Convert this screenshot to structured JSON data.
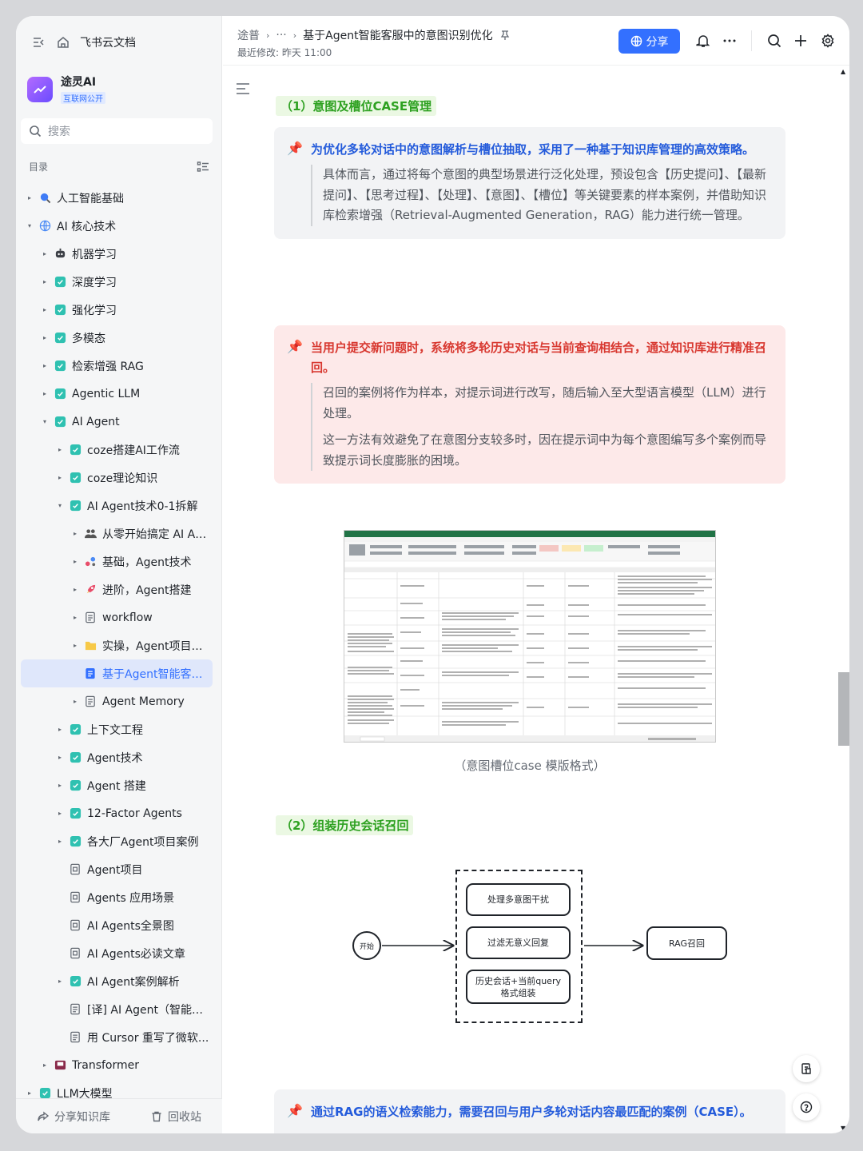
{
  "sidebar": {
    "home_title": "飞书云文档",
    "space": {
      "name": "途灵AI",
      "badge": "互联网公开"
    },
    "search_placeholder": "搜索",
    "toc_label": "目录",
    "items": [
      {
        "label": "人工智能基础",
        "level": 0,
        "caret": "▸",
        "icon": "search-icon"
      },
      {
        "label": "AI 核心技术",
        "level": 0,
        "caret": "▾",
        "icon": "globe-icon"
      },
      {
        "label": "机器学习",
        "level": 1,
        "caret": "▸",
        "icon": "robot-icon"
      },
      {
        "label": "深度学习",
        "level": 1,
        "caret": "▸",
        "icon": "wiki-icon"
      },
      {
        "label": "强化学习",
        "level": 1,
        "caret": "▸",
        "icon": "wiki-icon"
      },
      {
        "label": "多模态",
        "level": 1,
        "caret": "▸",
        "icon": "wiki-icon"
      },
      {
        "label": "检索增强 RAG",
        "level": 1,
        "caret": "▸",
        "icon": "wiki-icon"
      },
      {
        "label": "Agentic LLM",
        "level": 1,
        "caret": "▸",
        "icon": "wiki-icon"
      },
      {
        "label": "AI Agent",
        "level": 1,
        "caret": "▾",
        "icon": "wiki-icon"
      },
      {
        "label": "coze搭建AI工作流",
        "level": 2,
        "caret": "▸",
        "icon": "wiki-icon"
      },
      {
        "label": "coze理论知识",
        "level": 2,
        "caret": "▸",
        "icon": "wiki-icon"
      },
      {
        "label": "AI Agent技术0-1拆解",
        "level": 2,
        "caret": "▾",
        "icon": "wiki-icon"
      },
      {
        "label": "从零开始搞定 AI Ag...",
        "level": 3,
        "caret": "▸",
        "icon": "people-icon"
      },
      {
        "label": "基础，Agent技术",
        "level": 3,
        "caret": "▸",
        "icon": "molecule-icon"
      },
      {
        "label": "进阶，Agent搭建",
        "level": 3,
        "caret": "▸",
        "icon": "rocket-icon"
      },
      {
        "label": "workflow",
        "level": 3,
        "caret": "▸",
        "icon": "doc-icon"
      },
      {
        "label": "实操，Agent项目专项",
        "level": 3,
        "caret": "▸",
        "icon": "folder-icon"
      },
      {
        "label": "基于Agent智能客服...",
        "level": 3,
        "caret": "",
        "icon": "doc-blue-icon",
        "active": true
      },
      {
        "label": "Agent Memory",
        "level": 3,
        "caret": "▸",
        "icon": "doc-icon"
      },
      {
        "label": "上下文工程",
        "level": 2,
        "caret": "▸",
        "icon": "wiki-icon"
      },
      {
        "label": "Agent技术",
        "level": 2,
        "caret": "▸",
        "icon": "wiki-icon"
      },
      {
        "label": "Agent 搭建",
        "level": 2,
        "caret": "▸",
        "icon": "wiki-icon"
      },
      {
        "label": "12-Factor Agents",
        "level": 2,
        "caret": "▸",
        "icon": "wiki-icon"
      },
      {
        "label": "各大厂Agent项目案例",
        "level": 2,
        "caret": "▸",
        "icon": "wiki-icon"
      },
      {
        "label": "Agent项目",
        "level": 2,
        "caret": "",
        "icon": "board-icon"
      },
      {
        "label": "Agents 应用场景",
        "level": 2,
        "caret": "",
        "icon": "board-icon"
      },
      {
        "label": "AI Agents全景图",
        "level": 2,
        "caret": "",
        "icon": "board-icon"
      },
      {
        "label": "AI Agents必读文章",
        "level": 2,
        "caret": "",
        "icon": "board-icon"
      },
      {
        "label": "AI Agent案例解析",
        "level": 2,
        "caret": "▸",
        "icon": "wiki-icon"
      },
      {
        "label": "[译] AI Agent（智能体...",
        "level": 2,
        "caret": "",
        "icon": "doc-icon"
      },
      {
        "label": "用 Cursor 重写了微软...",
        "level": 2,
        "caret": "",
        "icon": "doc-icon"
      },
      {
        "label": "Transformer",
        "level": 1,
        "caret": "▸",
        "icon": "film-icon"
      },
      {
        "label": "LLM大模型",
        "level": 0,
        "caret": "▸",
        "icon": "wiki-icon"
      }
    ],
    "bottom": {
      "share": "分享知识库",
      "trash": "回收站"
    }
  },
  "header": {
    "breadcrumb": [
      "途普",
      "···",
      "基于Agent智能客服中的意图识别优化"
    ],
    "modified": "最近修改: 昨天 11:00",
    "share_label": "分享"
  },
  "doc": {
    "section1": "（1）意图及槽位CASE管理",
    "callout1": {
      "title": "为优化多轮对话中的意图解析与槽位抽取，采用了一种基于知识库管理的高效策略。",
      "body": "具体而言，通过将每个意图的典型场景进行泛化处理，预设包含【历史提问】、【最新提问】、【思考过程】、【处理】、【意图】、【槽位】等关键要素的样本案例，并借助知识库检索增强（Retrieval-Augmented Generation，RAG）能力进行统一管理。"
    },
    "callout2": {
      "title": "当用户提交新问题时，系统将多轮历史对话与当前查询相结合，通过知识库进行精准召回。",
      "body1": "召回的案例将作为样本，对提示词进行改写，随后输入至大型语言模型（LLM）进行处理。",
      "body2": "这一方法有效避免了在意图分支较多时，因在提示词中为每个意图编写多个案例而导致提示词长度膨胀的困境。"
    },
    "image_caption": "（意图槽位case 模版格式）",
    "section2": "（2）组装历史会话召回",
    "flow": {
      "start": "开始",
      "step1": "处理多意图干扰",
      "step2": "过滤无意义回复",
      "step3": "历史会话+当前query格式组装",
      "end": "RAG召回"
    },
    "callout3": {
      "title": "通过RAG的语义检索能力，需要召回与用户多轮对话内容最匹配的案例（CASE）。"
    }
  },
  "colors": {
    "accent": "#3370ff",
    "green_heading": "#2ea121",
    "red_title": "#d83931",
    "blue_title": "#245bdb"
  }
}
